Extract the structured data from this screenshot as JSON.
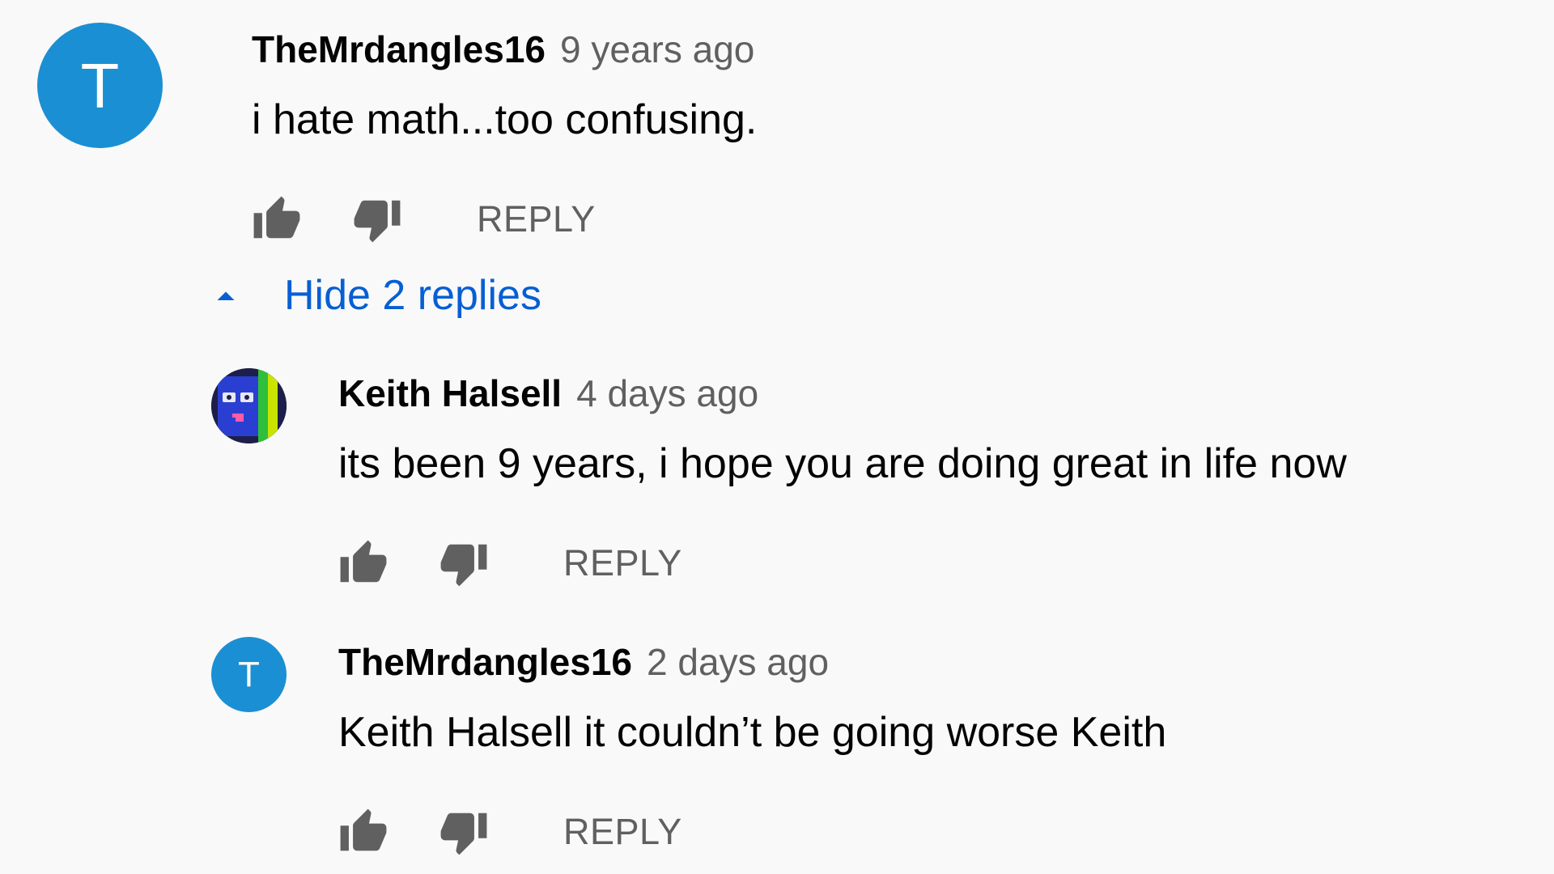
{
  "comments": [
    {
      "author": "TheMrdangles16",
      "time": "9 years ago",
      "text": "i hate math...too confusing.",
      "avatar_letter": "T",
      "avatar_color": "#1b8fd3",
      "reply_label": "REPLY"
    }
  ],
  "replies_toggle": {
    "label": "Hide 2 replies",
    "icon": "caret-up-icon",
    "color": "#065fd4"
  },
  "replies": [
    {
      "author": "Keith Halsell",
      "time": "4 days ago",
      "text": "its been 9 years, i hope you are doing great in life now",
      "avatar_icon": "robot-face-avatar",
      "reply_label": "REPLY"
    },
    {
      "author": "TheMrdangles16",
      "time": "2 days ago",
      "text": "Keith Halsell it couldn’t be going worse Keith",
      "avatar_letter": "T",
      "avatar_color": "#1b8fd3",
      "reply_label": "REPLY"
    }
  ],
  "icons": {
    "like": "thumbs-up-icon",
    "dislike": "thumbs-down-icon"
  },
  "colors": {
    "background": "#f9f9f9",
    "text": "#030303",
    "secondary_text": "#606060",
    "link": "#065fd4"
  }
}
